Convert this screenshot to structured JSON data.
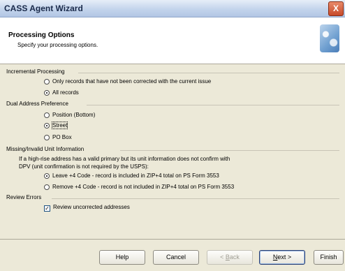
{
  "window": {
    "title": "CASS Agent Wizard",
    "close_glyph": "X"
  },
  "header": {
    "title": "Processing Options",
    "subtitle": "Specify your processing options.",
    "icon": "wizard-globe-icon"
  },
  "incremental": {
    "title": "Incremental Processing",
    "options": [
      {
        "label": "Only records that have not been corrected with the current issue",
        "checked": false
      },
      {
        "label": "All records",
        "checked": true
      }
    ]
  },
  "dual_address": {
    "title": "Dual Address Preference",
    "options": [
      {
        "label": "Position (Bottom)",
        "checked": false
      },
      {
        "label": "Street",
        "checked": true
      },
      {
        "label": "PO Box",
        "checked": false
      }
    ]
  },
  "missing_unit": {
    "title": "Missing/Invalid Unit Information",
    "description_line1": "If a high-rise address has a valid primary but its unit information does not confirm with",
    "description_line2": "DPV (unit confirmation is not required by the USPS):",
    "options": [
      {
        "label": "Leave +4 Code - record is included in ZIP+4 total on PS Form 3553",
        "checked": true
      },
      {
        "label": "Remove +4 Code - record is not included in ZIP+4 total on PS Form 3553",
        "checked": false
      }
    ]
  },
  "review": {
    "title": "Review Errors",
    "checkbox_label": "Review uncorrected addresses",
    "checked": true
  },
  "buttons": {
    "help": "Help",
    "cancel": "Cancel",
    "back_mnemonic": "B",
    "back_rest": "ack",
    "back_prefix": "< ",
    "next_mnemonic": "N",
    "next_rest": "ext >",
    "finish": "Finish"
  }
}
